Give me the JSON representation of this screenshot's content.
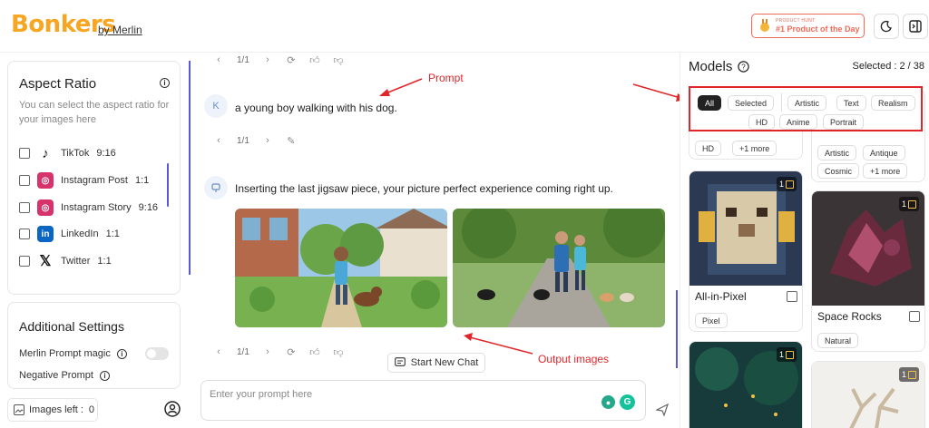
{
  "header": {
    "logo": "Bonkers",
    "logo_sub": "by Merlin",
    "product_hunt_small": "PRODUCT HUNT",
    "product_hunt_big": "#1 Product of the Day",
    "theme_icon": "moon-icon",
    "sidebar_icon": "sidebar-toggle-icon"
  },
  "aspect": {
    "title": "Aspect Ratio",
    "desc": "You can select the aspect ratio for your images here",
    "items": [
      {
        "label": "TikTok",
        "ratio": "9:16",
        "icon": "tiktok-icon"
      },
      {
        "label": "Instagram Post",
        "ratio": "1:1",
        "icon": "instagram-icon"
      },
      {
        "label": "Instagram Story",
        "ratio": "9:16",
        "icon": "instagram-icon"
      },
      {
        "label": "LinkedIn",
        "ratio": "1:1",
        "icon": "linkedin-icon"
      },
      {
        "label": "Twitter",
        "ratio": "1:1",
        "icon": "x-icon"
      }
    ]
  },
  "settings": {
    "title": "Additional Settings",
    "magic": "Merlin Prompt magic",
    "negative": "Negative Prompt"
  },
  "footer_left": {
    "images_left_label": "Images left :",
    "images_left_value": "0"
  },
  "chat": {
    "page_top": "1/1",
    "page_prompt": "1/1",
    "page_bottom": "1/1",
    "user_avatar": "K",
    "prompt_text": "a young boy walking with his dog.",
    "bot_text": "Inserting the last jigsaw piece, your picture perfect experience coming right up.",
    "start_new_chat": "Start New Chat",
    "input_placeholder": "Enter your prompt here"
  },
  "annotations": {
    "prompt": "Prompt",
    "output": "Output images"
  },
  "models": {
    "title": "Models",
    "selected_label": "Selected : 2 / 38",
    "filters_row1": [
      "All",
      "Selected",
      "Artistic",
      "Text",
      "Realism"
    ],
    "filters_row2": [
      "HD",
      "Anime",
      "Portrait"
    ],
    "card_left_top_tags": [
      "HD",
      "+1 more"
    ],
    "card_right_top_tags": [
      "Artistic",
      "Antique",
      "Cosmic",
      "+1 more"
    ],
    "card1": {
      "name": "All-in-Pixel",
      "tag": "Pixel",
      "count": "1"
    },
    "card2": {
      "name": "Space Rocks",
      "tag": "Natural",
      "count": "1"
    },
    "card3_count": "1",
    "card4_count": "1"
  },
  "colors": {
    "brand": "#f6a623",
    "accent": "#5a5ad6",
    "annotation": "#e0262a"
  }
}
